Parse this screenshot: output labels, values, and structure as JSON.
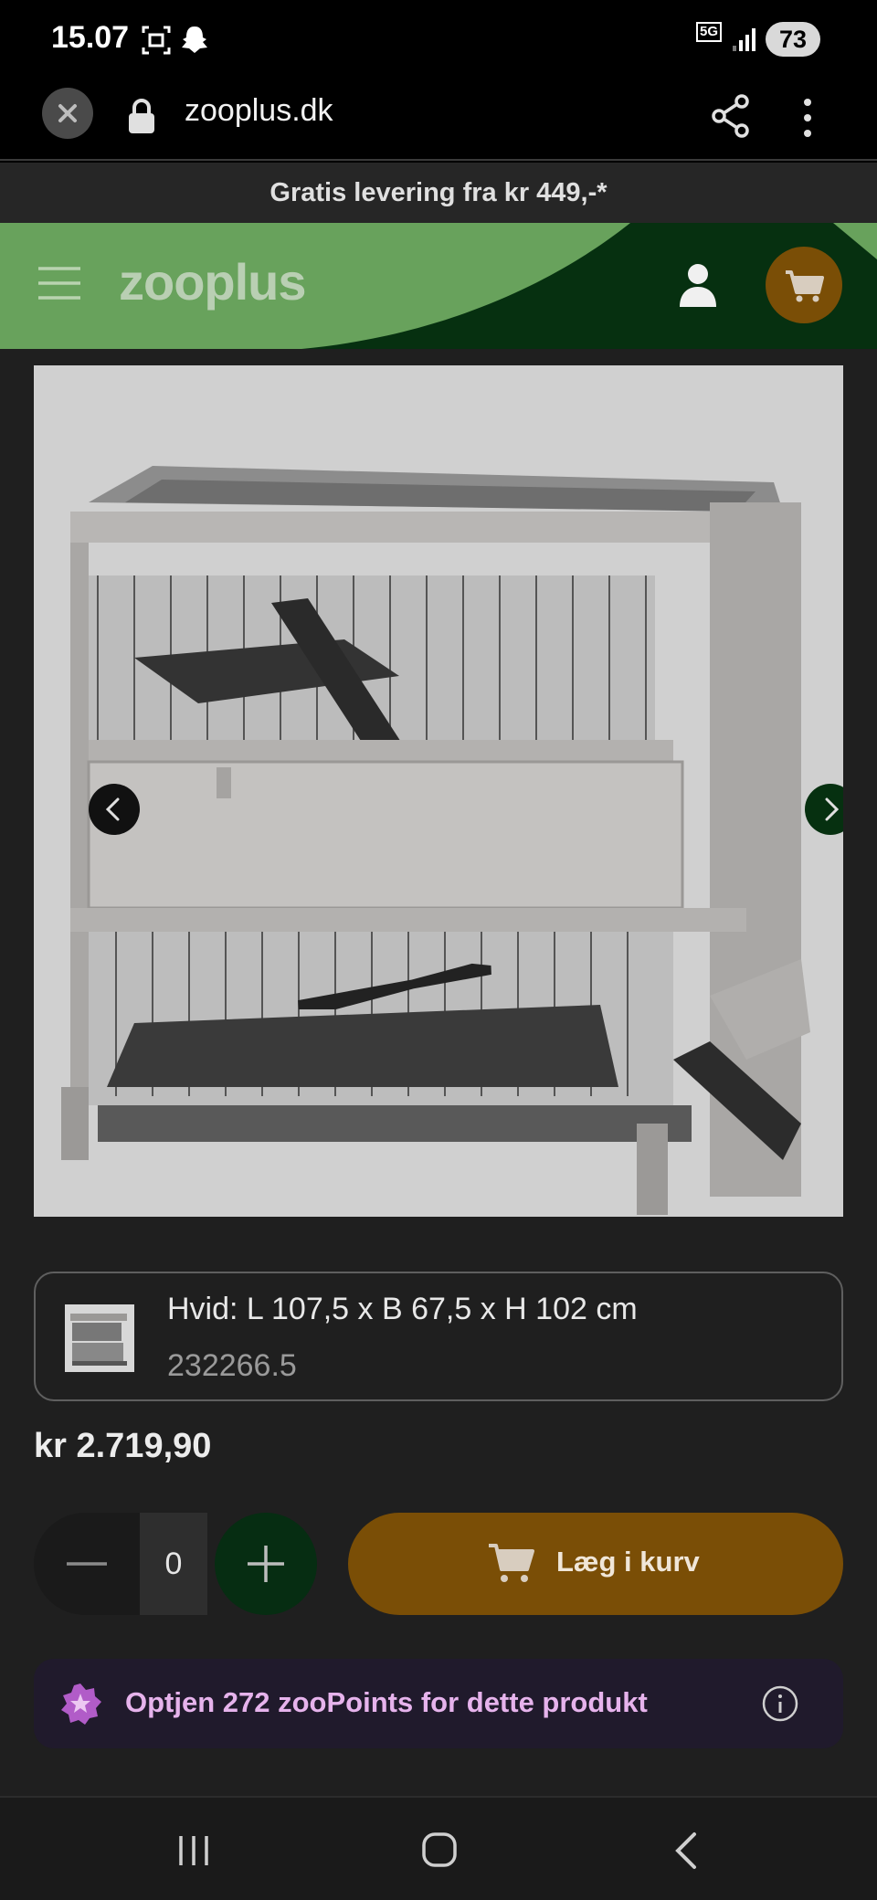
{
  "status_bar": {
    "time": "15.07",
    "network": "5G",
    "battery": "73"
  },
  "browser": {
    "url": "zooplus.dk"
  },
  "promo": {
    "text": "Gratis levering fra kr 449,-*"
  },
  "header": {
    "logo": "zooplus"
  },
  "product": {
    "variant_title": "Hvid: L 107,5 x B 67,5 x H 102 cm",
    "variant_sku": "232266.5",
    "price": "kr 2.719,90",
    "quantity": "0",
    "add_to_cart_label": "Læg i kurv",
    "points_text": "Optjen 272 zooPoints for dette produkt"
  },
  "colors": {
    "brand_green": "#68a25c",
    "dark_green": "#062d12",
    "cart_brown": "#7a4e06",
    "points_purple": "#201a2c"
  }
}
